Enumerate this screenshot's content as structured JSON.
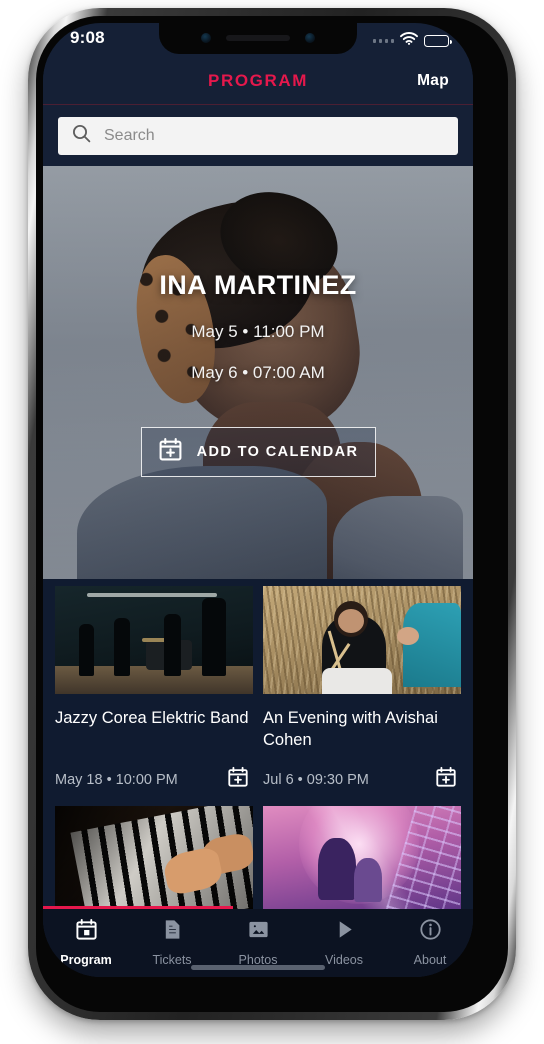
{
  "status_bar": {
    "time": "9:08",
    "signal_icon": "signal-dots-icon",
    "wifi_icon": "wifi-icon",
    "battery_icon": "battery-icon"
  },
  "header": {
    "title": "PROGRAM",
    "title_color": "#e5184c",
    "map_label": "Map"
  },
  "search": {
    "placeholder": "Search",
    "value": "",
    "icon": "search-icon"
  },
  "hero": {
    "title": "INA MARTINEZ",
    "date_1": "May 5 • 11:00 PM",
    "date_2": "May 6 • 07:00 AM",
    "add_to_calendar_label": "ADD TO CALENDAR",
    "calendar_icon": "calendar-plus-icon"
  },
  "events": [
    {
      "title": "Jazzy Corea Elektric Band",
      "date": "May 18 • 10:00 PM",
      "thumb": "thumb-stage",
      "calendar_icon": "calendar-plus-icon"
    },
    {
      "title": "An Evening with Avishai Cohen",
      "date": "Jul 6 • 09:30 PM",
      "thumb": "thumb-drummer",
      "calendar_icon": "calendar-plus-icon"
    }
  ],
  "events_next_row": [
    {
      "thumb": "thumb-piano"
    },
    {
      "thumb": "thumb-concert"
    }
  ],
  "tabs": [
    {
      "label": "Program",
      "icon": "calendar-icon",
      "active": true
    },
    {
      "label": "Tickets",
      "icon": "document-icon",
      "active": false
    },
    {
      "label": "Photos",
      "icon": "image-icon",
      "active": false
    },
    {
      "label": "Videos",
      "icon": "play-icon",
      "active": false
    },
    {
      "label": "About",
      "icon": "info-icon",
      "active": false
    }
  ],
  "theme": {
    "accent": "#e5184c",
    "screen_bg": "#152036",
    "content_bg": "#101b30",
    "tabbar_bg": "#0c1322",
    "muted_text": "#8b93a1"
  }
}
